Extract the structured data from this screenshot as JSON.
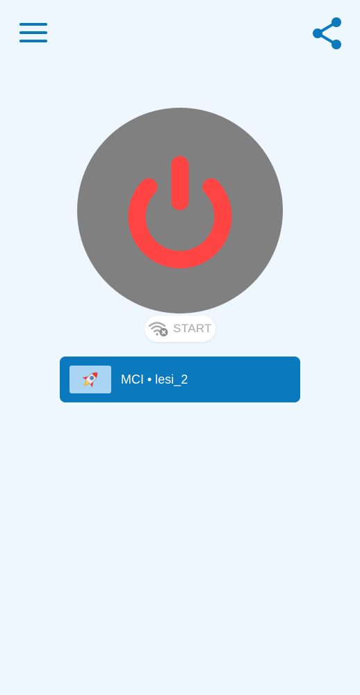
{
  "app": {
    "accent_color": "#0a79be",
    "background_color": "#eef6fe",
    "power_color": "#ff4444",
    "power_bg_color": "#808080"
  },
  "header": {
    "menu_icon": "hamburger-menu-icon",
    "share_icon": "share-icon"
  },
  "power": {
    "icon": "power-icon",
    "state": "disconnected"
  },
  "status": {
    "icon": "wifi-off-icon",
    "label": "START"
  },
  "server": {
    "icon": "rocket-icon",
    "label": "MCI • lesi_2"
  }
}
